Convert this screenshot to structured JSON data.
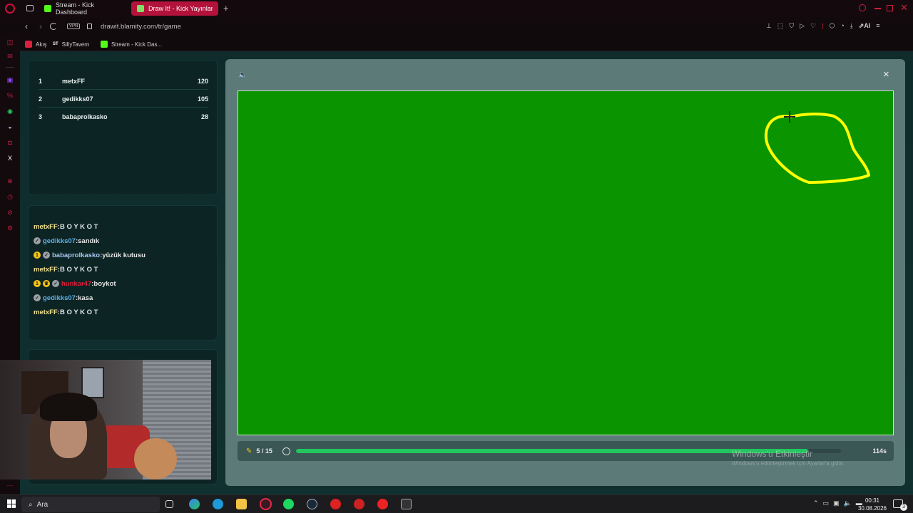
{
  "browser": {
    "tabs": [
      {
        "label": "Stream - Kick Dashboard",
        "active": false
      },
      {
        "label": "Draw It! - Kick Yayınları",
        "active": true
      }
    ],
    "url": "drawit.blamity.com/tr/game",
    "vpn_label": "VPN",
    "ai_label": "AI",
    "bookmarks": [
      "Akış",
      "SillyTavern",
      "Stream - Kick Das..."
    ],
    "sillytavern_badge": "ST"
  },
  "leaderboard": [
    {
      "rank": "1",
      "name": "metxFF",
      "score": "120"
    },
    {
      "rank": "2",
      "name": "gedikks07",
      "score": "105"
    },
    {
      "rank": "3",
      "name": "babaprolkasko",
      "score": "28"
    }
  ],
  "chat": [
    {
      "user": "metxFF",
      "message": "B O Y K O T",
      "user_color": "#f2e28c",
      "badges": []
    },
    {
      "user": "gedikks07",
      "message": "sandık",
      "user_color": "#5fb0e8",
      "badges": [
        "shield"
      ]
    },
    {
      "user": "babaprolkasko",
      "message": "yüzük kutusu",
      "user_color": "#a8c8f0",
      "badges": [
        "one",
        "shield"
      ]
    },
    {
      "user": "metxFF",
      "message": "B O Y K O T",
      "user_color": "#f2e28c",
      "badges": []
    },
    {
      "user": "hunkar47",
      "message": "boykot",
      "user_color": "#d8203c",
      "badges": [
        "one",
        "crown",
        "shield"
      ]
    },
    {
      "user": "gedikks07",
      "message": "kasa",
      "user_color": "#5fb0e8",
      "badges": [
        "shield"
      ]
    },
    {
      "user": "metxFF",
      "message": "B O Y K O T",
      "user_color": "#f2e28c",
      "badges": []
    }
  ],
  "game": {
    "round": "5 / 15",
    "progress": 0.94,
    "timer": "114s",
    "canvas_color": "#0a9400",
    "stroke_color": "#ffff00",
    "close_label": "×"
  },
  "watermark": {
    "title": "Windows'u Etkinleştir",
    "subtitle": "Windows'u etkinleştirmek için Ayarlar'a gidin."
  },
  "taskbar": {
    "search_placeholder": "Ara",
    "time": "00:31",
    "date": "30.08.2026",
    "notification_count": "3"
  },
  "colors": {
    "accent": "#b3123b",
    "page_bg": "#0f2c2c",
    "progress": "#22c55e"
  }
}
